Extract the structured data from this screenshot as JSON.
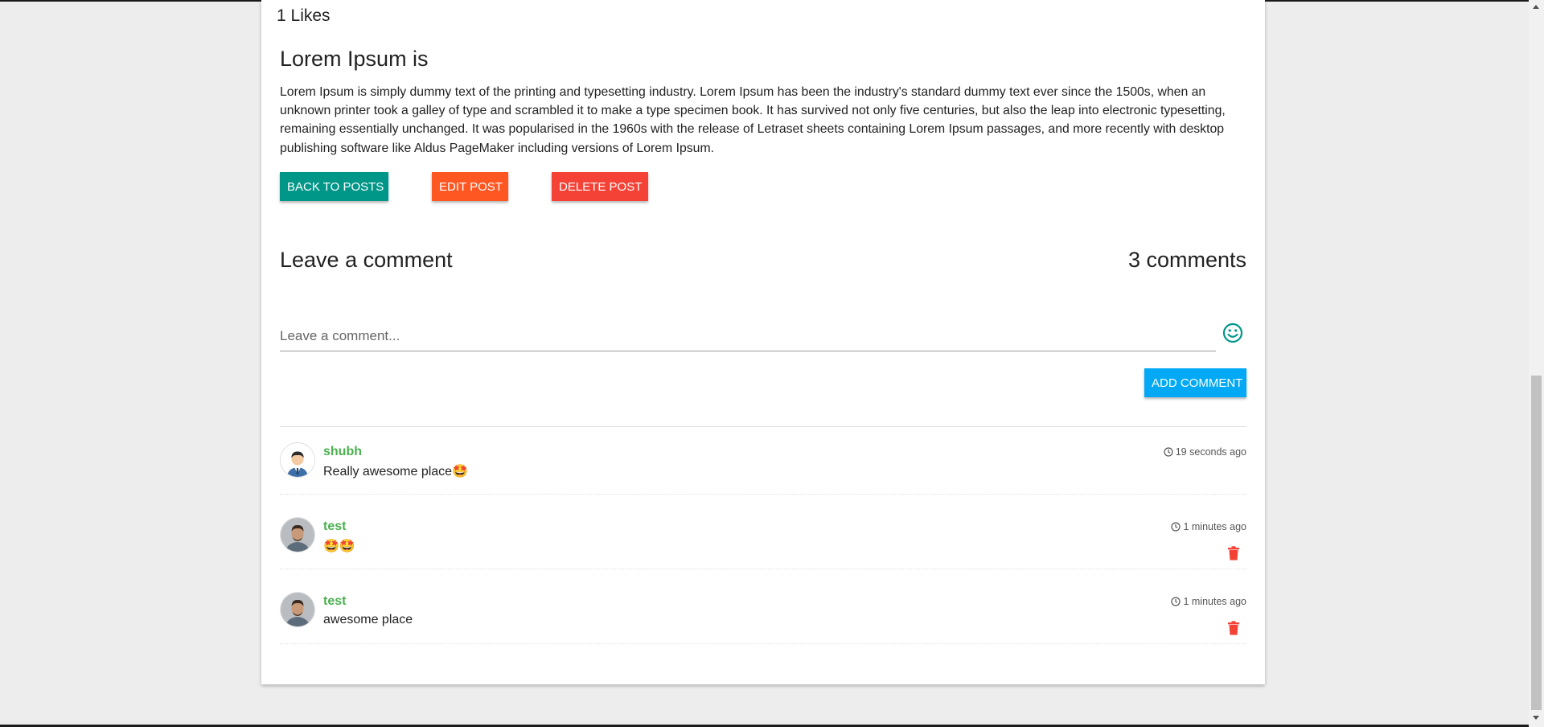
{
  "post": {
    "likes": "1 Likes",
    "title": "Lorem Ipsum is",
    "body": "Lorem Ipsum is simply dummy text of the printing and typesetting industry. Lorem Ipsum has been the industry's standard dummy text ever since the 1500s, when an unknown printer took a galley of type and scrambled it to make a type specimen book. It has survived not only five centuries, but also the leap into electronic typesetting, remaining essentially unchanged. It was popularised in the 1960s with the release of Letraset sheets containing Lorem Ipsum passages, and more recently with desktop publishing software like Aldus PageMaker including versions of Lorem Ipsum."
  },
  "actions": {
    "back_label": "BACK TO POSTS",
    "edit_label": "EDIT POST",
    "delete_label": "DELETE POST"
  },
  "comment_form": {
    "heading": "Leave a comment",
    "count": "3 comments",
    "placeholder": "Leave a comment...",
    "value": "",
    "emoji_icon": "smiley-icon",
    "add_label": "ADD COMMENT"
  },
  "comments": [
    {
      "author": "shubh",
      "text": "Really awesome place🤩",
      "time": "19 seconds ago",
      "avatar": "cartoon-man-avatar",
      "deletable": false
    },
    {
      "author": "test",
      "text": "🤩🤩",
      "time": "1 minutes ago",
      "avatar": "photo-man-avatar",
      "deletable": true
    },
    {
      "author": "test",
      "text": "awesome place",
      "time": "1 minutes ago",
      "avatar": "photo-man-avatar",
      "deletable": true
    }
  ],
  "colors": {
    "back": "#009688",
    "edit": "#ff5722",
    "delete": "#f44336",
    "add": "#03a9f4",
    "author": "#4caf50",
    "trash": "#f44336",
    "emoji": "#009688"
  }
}
